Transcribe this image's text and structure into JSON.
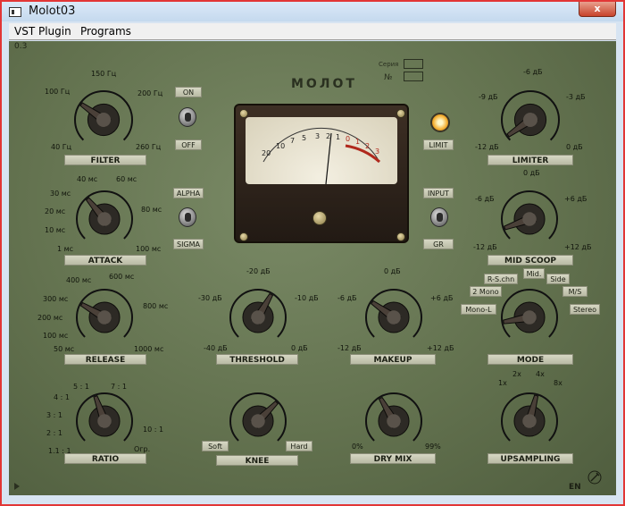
{
  "window": {
    "title": "Molot03",
    "close_glyph": "x"
  },
  "menu": [
    "VST Plugin",
    "Programs"
  ],
  "panel": {
    "version": "0.3",
    "brand": "МОЛОТ",
    "series_label": "Серия",
    "number_label": "№",
    "en_label": "EN"
  },
  "meter": {
    "scale_top": [
      "20",
      "10",
      "7",
      "5",
      "3",
      "2",
      "1",
      "0",
      "1",
      "2",
      "3"
    ]
  },
  "knobs": {
    "filter": {
      "label": "FILTER",
      "ticks": [
        "100 Гц",
        "150 Гц",
        "200 Гц",
        "40 Гц",
        "260 Гц"
      ]
    },
    "attack": {
      "label": "ATTACK",
      "ticks": [
        "40 мс",
        "60 мс",
        "30 мс",
        "80 мс",
        "20 мс",
        "10 мс",
        "1 мс",
        "100 мс"
      ]
    },
    "release": {
      "label": "RELEASE",
      "ticks": [
        "400 мс",
        "600 мс",
        "300 мс",
        "800 мс",
        "200 мс",
        "100 мс",
        "50 мс",
        "1000 мс"
      ]
    },
    "ratio": {
      "label": "RATIO",
      "ticks": [
        "5 : 1",
        "7 : 1",
        "4 : 1",
        "3 : 1",
        "2 : 1",
        "1.1 : 1",
        "10 : 1",
        "Огр."
      ]
    },
    "threshold": {
      "label": "THRESHOLD",
      "ticks": [
        "-20 дБ",
        "-30 дБ",
        "-10 дБ",
        "-40 дБ",
        "0 дБ"
      ]
    },
    "knee": {
      "label": "KNEE",
      "ticks": [
        "Soft",
        "Hard"
      ]
    },
    "makeup": {
      "label": "MAKEUP",
      "ticks": [
        "0 дБ",
        "-6 дБ",
        "+6 дБ",
        "-12 дБ",
        "+12 дБ"
      ]
    },
    "drymix": {
      "label": "DRY MIX",
      "ticks": [
        "0%",
        "99%"
      ]
    },
    "limiter": {
      "label": "LIMITER",
      "ticks": [
        "-6 дБ",
        "-9 дБ",
        "-3 дБ",
        "-12 дБ",
        "0 дБ"
      ]
    },
    "midscoop": {
      "label": "MID SCOOP",
      "ticks": [
        "0 дБ",
        "-6 дБ",
        "+6 дБ",
        "-12 дБ",
        "+12 дБ"
      ]
    },
    "mode": {
      "label": "MODE",
      "ticks": [
        "Mid.",
        "R-S.chn",
        "Side",
        "2 Mono",
        "M/S",
        "Mono-L",
        "Stereo"
      ]
    },
    "upsampling": {
      "label": "UPSAMPLING",
      "ticks": [
        "2x",
        "4x",
        "1x",
        "8x"
      ]
    }
  },
  "switches": {
    "filter_on": "ON",
    "filter_off": "OFF",
    "alpha": "ALPHA",
    "sigma": "SIGMA",
    "limit": "LIMIT",
    "input": "INPUT",
    "gr": "GR"
  }
}
